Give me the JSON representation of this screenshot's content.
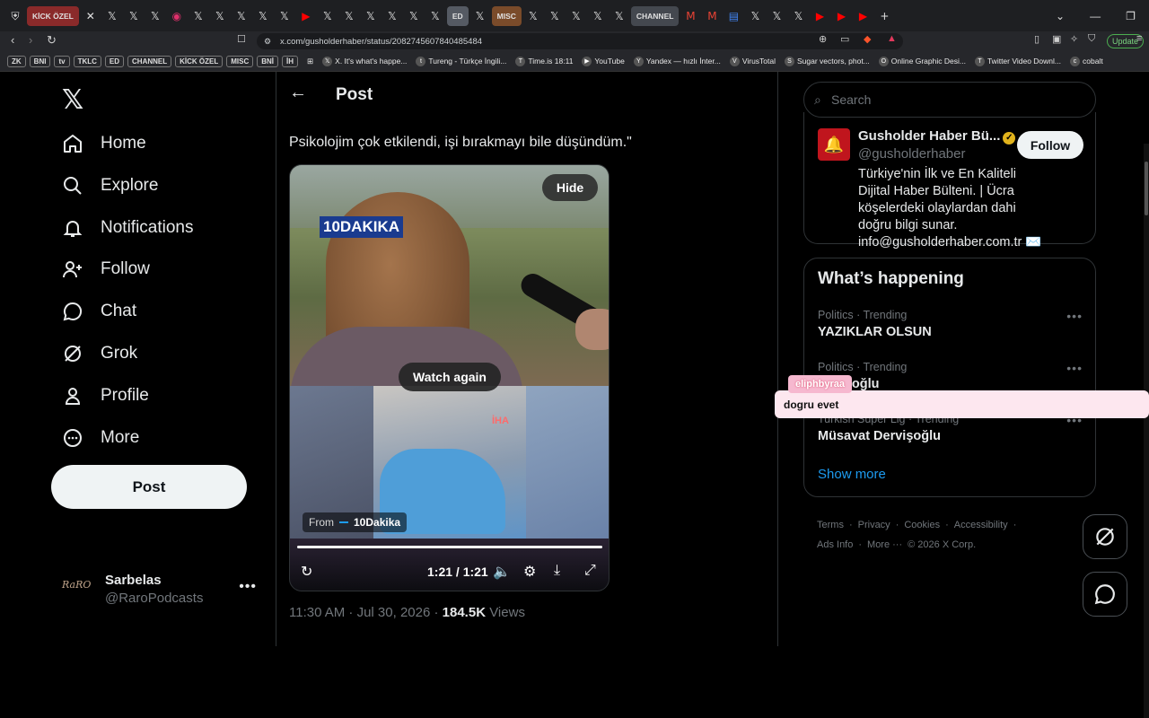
{
  "browser": {
    "tabs": [
      {
        "label": "KİCK ÖZEL",
        "kind": "group",
        "color": "#8a2a2a"
      },
      {
        "label": "✕",
        "kind": "icon"
      },
      {
        "label": "𝕏",
        "kind": "icon"
      },
      {
        "label": "𝕏",
        "kind": "icon"
      },
      {
        "label": "𝕏",
        "kind": "icon"
      },
      {
        "label": "◉",
        "kind": "icon",
        "color": "#e1306c"
      },
      {
        "label": "𝕏",
        "kind": "icon"
      },
      {
        "label": "𝕏",
        "kind": "icon"
      },
      {
        "label": "𝕏",
        "kind": "icon"
      },
      {
        "label": "𝕏",
        "kind": "icon"
      },
      {
        "label": "𝕏",
        "kind": "icon"
      },
      {
        "label": "▶",
        "kind": "icon",
        "color": "#ff0000"
      },
      {
        "label": "𝕏",
        "kind": "icon"
      },
      {
        "label": "𝕏",
        "kind": "icon"
      },
      {
        "label": "𝕏",
        "kind": "icon"
      },
      {
        "label": "𝕏",
        "kind": "icon"
      },
      {
        "label": "𝕏",
        "kind": "icon"
      },
      {
        "label": "𝕏",
        "kind": "icon"
      },
      {
        "label": "ED",
        "kind": "group",
        "color": "#555a63"
      },
      {
        "label": "𝕏",
        "kind": "icon"
      },
      {
        "label": "MISC",
        "kind": "group",
        "color": "#7a4b2a"
      },
      {
        "label": "𝕏",
        "kind": "icon"
      },
      {
        "label": "𝕏",
        "kind": "icon"
      },
      {
        "label": "𝕏",
        "kind": "icon"
      },
      {
        "label": "𝕏",
        "kind": "icon"
      },
      {
        "label": "𝕏",
        "kind": "icon"
      },
      {
        "label": "CHANNEL",
        "kind": "group",
        "color": "#44484f"
      },
      {
        "label": "M",
        "kind": "icon",
        "color": "#ea4335"
      },
      {
        "label": "M",
        "kind": "icon",
        "color": "#ea4335"
      },
      {
        "label": "▤",
        "kind": "icon",
        "color": "#4285f4"
      },
      {
        "label": "𝕏",
        "kind": "icon"
      },
      {
        "label": "𝕏",
        "kind": "icon"
      },
      {
        "label": "𝕏",
        "kind": "icon"
      },
      {
        "label": "▶",
        "kind": "icon",
        "color": "#ff0000"
      },
      {
        "label": "▶",
        "kind": "icon",
        "color": "#ff0000"
      },
      {
        "label": "▶",
        "kind": "icon",
        "color": "#ff0000"
      },
      {
        "label": "+",
        "kind": "icon"
      }
    ],
    "url": "x.com/gusholderhaber/status/2082745607840485484",
    "update_label": "Update",
    "bookmark_groups": [
      "ZK",
      "BNI",
      "tv",
      "TKLC",
      "ED",
      "CHANNEL",
      "KİCK ÖZEL",
      "MISC",
      "BNİ",
      "İH"
    ],
    "bookmarks": [
      {
        "label": "X. It's what's happe...",
        "icon": "𝕏"
      },
      {
        "label": "Tureng - Türkçe İngili...",
        "icon": "t"
      },
      {
        "label": "Time.is 18:11",
        "icon": "T"
      },
      {
        "label": "YouTube",
        "icon": "▶"
      },
      {
        "label": "Yandex — hızlı İnter...",
        "icon": "Y"
      },
      {
        "label": "VirusTotal",
        "icon": "V"
      },
      {
        "label": "Sugar vectors, phot...",
        "icon": "S"
      },
      {
        "label": "Online Graphic Desi...",
        "icon": "O"
      },
      {
        "label": "Twitter Video Downl...",
        "icon": "T"
      },
      {
        "label": "cobalt",
        "icon": "c"
      }
    ]
  },
  "nav": {
    "items": [
      {
        "label": "Home",
        "icon": "home-icon"
      },
      {
        "label": "Explore",
        "icon": "search-icon"
      },
      {
        "label": "Notifications",
        "icon": "bell-icon"
      },
      {
        "label": "Follow",
        "icon": "person-plus-icon"
      },
      {
        "label": "Chat",
        "icon": "chat-icon"
      },
      {
        "label": "Grok",
        "icon": "grok-icon"
      },
      {
        "label": "Profile",
        "icon": "person-icon"
      },
      {
        "label": "More",
        "icon": "more-circle-icon"
      }
    ],
    "post_label": "Post"
  },
  "account": {
    "name": "Sarbelas",
    "handle": "@RaroPodcasts",
    "avatar_text": "RaRO"
  },
  "main": {
    "header_title": "Post",
    "tweet_text": "Psikolojim çok etkilendi, işi bırakmayı bile düşündüm.\"",
    "video": {
      "hide_label": "Hide",
      "news_badge": "10DAKIKA",
      "watch_again_label": "Watch again",
      "from_prefix": "From",
      "from_source": "10Dakika",
      "time": "1:21 / 1:21",
      "watermark": "İHA",
      "progress": 1.0
    },
    "timestamp": "11:30 AM · Jul 30, 2026 · ",
    "views_count": "184.5K",
    "views_label": " Views"
  },
  "right": {
    "search_placeholder": "Search",
    "profile_card": {
      "name": "Gusholder Haber Bü...",
      "handle": "@gusholderhaber",
      "bio": "Türkiye'nin İlk ve En Kaliteli Dijital Haber Bülteni. | Ücra köşelerdeki olaylardan dahi doğru bilgi sunar. info@gusholderhaber.com.tr ✉️",
      "follow_label": "Follow"
    },
    "trends_title": "What’s happening",
    "trends": [
      {
        "category": "Politics · Trending",
        "title": "YAZIKLAR OLSUN"
      },
      {
        "category": "Politics · Trending",
        "title": "İmamoğlu"
      },
      {
        "category": "Turkish Super Lig · Trending",
        "title": "Müsavat Dervişoğlu"
      }
    ],
    "show_more": "Show more",
    "footer": [
      "Terms",
      "·",
      "Privacy",
      "·",
      "Cookies",
      "·",
      "Accessibility",
      "·",
      "Ads Info",
      "·",
      "More ···",
      "© 2026 X Corp."
    ]
  },
  "overlay": {
    "chat_user": "eliphbyraa",
    "chat_message": "dogru evet"
  }
}
